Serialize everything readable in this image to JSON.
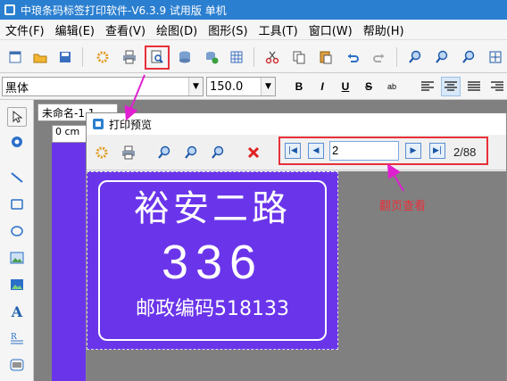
{
  "window": {
    "title": "中琅条码标签打印软件-V6.3.9 试用版 单机"
  },
  "menu": [
    "文件(F)",
    "编辑(E)",
    "查看(V)",
    "绘图(D)",
    "图形(S)",
    "工具(T)",
    "窗口(W)",
    "帮助(H)"
  ],
  "toolbar": {
    "icons": [
      "new-icon",
      "open-icon",
      "save-icon",
      "settings-icon",
      "print-icon",
      "print-preview-icon",
      "database-icon",
      "database-add-icon",
      "grid-icon",
      "cut-icon",
      "copy-icon",
      "paste-icon",
      "undo-icon",
      "redo-icon",
      "zoom-in-icon",
      "zoom-out-icon",
      "zoom-fit-icon",
      "fit-page-icon"
    ]
  },
  "format_bar": {
    "font_name": "黑体",
    "font_size": "150.0",
    "bold_label": "B",
    "italic_label": "I",
    "underline_label": "U",
    "strike_label": "S",
    "special_label": "ab"
  },
  "document_tab": {
    "label": "未命名-1 1"
  },
  "ruler_label": "0 cm",
  "preview": {
    "title": "打印预览",
    "page_input": "2",
    "page_count": "2/88",
    "label": {
      "line1": "裕安二路",
      "line2": "336",
      "line3": "邮政编码518133"
    }
  },
  "annotation": {
    "text": "翻页查看",
    "color": "#e8303a"
  },
  "colors": {
    "accent": "#2b7fd0",
    "label_bg": "#6a35ea",
    "highlight": "#e8303a"
  }
}
